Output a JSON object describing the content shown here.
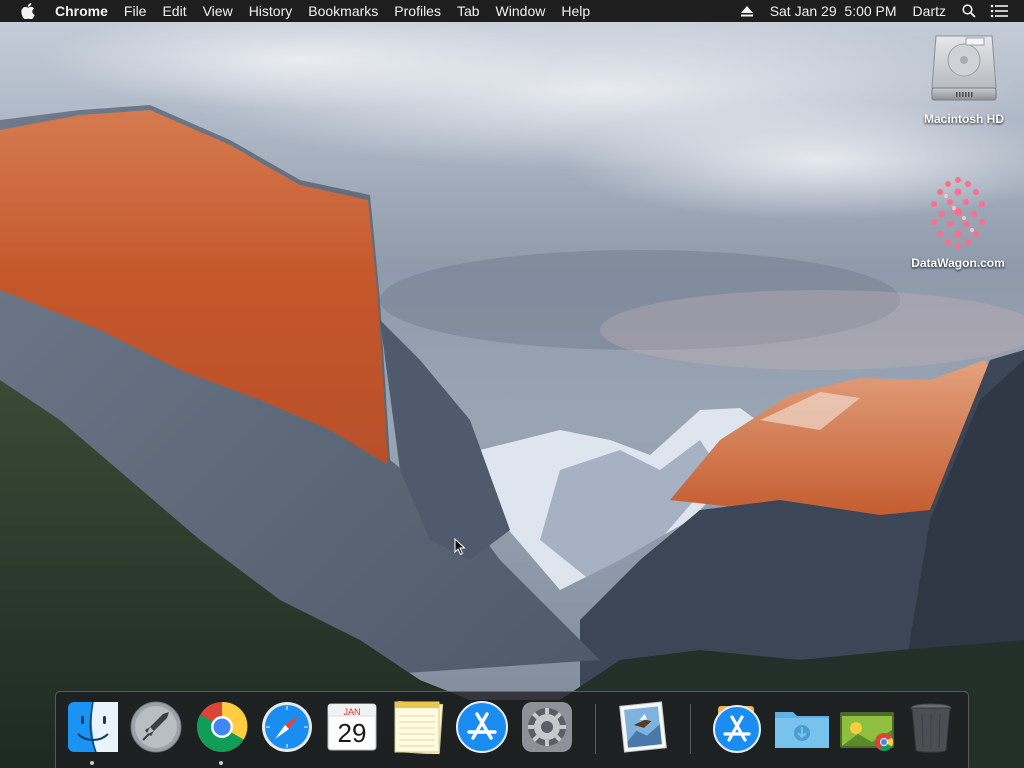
{
  "menubar": {
    "apple_icon": "apple-logo-icon",
    "app_name": "Chrome",
    "menus": [
      "File",
      "Edit",
      "View",
      "History",
      "Bookmarks",
      "Profiles",
      "Tab",
      "Window",
      "Help"
    ],
    "status": {
      "eject_icon": "eject-icon",
      "datetime": "Sat Jan 29  5:00 PM",
      "user": "Dartz",
      "search_icon": "spotlight-search-icon",
      "notification_icon": "notification-center-icon"
    }
  },
  "desktop": {
    "icons": [
      {
        "label": "Macintosh HD",
        "icon": "hard-drive-icon"
      },
      {
        "label": "DataWagon.com",
        "icon": "datawagon-icon"
      }
    ]
  },
  "dock": {
    "items": [
      {
        "name": "Finder",
        "icon": "finder-icon",
        "running": true
      },
      {
        "name": "Launchpad",
        "icon": "launchpad-icon",
        "running": false
      },
      {
        "name": "Google Chrome",
        "icon": "chrome-icon",
        "running": true
      },
      {
        "name": "Safari",
        "icon": "safari-icon",
        "running": false
      },
      {
        "name": "Calendar",
        "icon": "calendar-icon",
        "running": false,
        "month": "JAN",
        "day": "29"
      },
      {
        "name": "Notes",
        "icon": "notes-icon",
        "running": false
      },
      {
        "name": "App Store",
        "icon": "app-store-icon",
        "running": false
      },
      {
        "name": "System Preferences",
        "icon": "system-preferences-icon",
        "running": false
      },
      {
        "name": "Mail",
        "icon": "mail-stamp-icon",
        "running": false
      },
      {
        "name": "Applications",
        "icon": "applications-stack-icon",
        "running": false
      },
      {
        "name": "Downloads",
        "icon": "downloads-folder-icon",
        "running": false
      },
      {
        "name": "Chrome Apps",
        "icon": "chrome-apps-folder-icon",
        "running": false
      },
      {
        "name": "Trash",
        "icon": "trash-icon",
        "running": false
      }
    ]
  },
  "colors": {
    "menubar_bg": "#1e1e1f",
    "dock_bg": "#1e1e20",
    "accent_blue": "#1b8df2"
  }
}
